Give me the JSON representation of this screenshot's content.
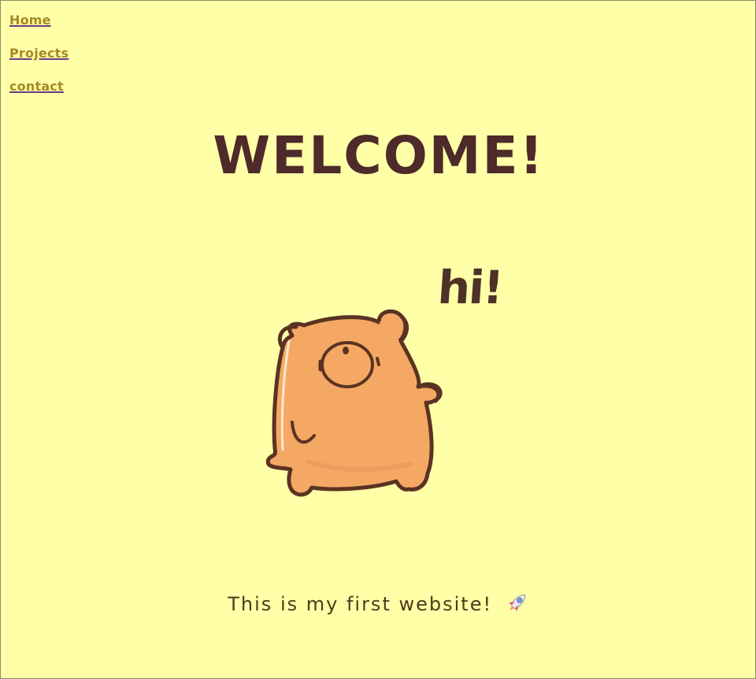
{
  "nav": {
    "items": [
      {
        "label": "Home"
      },
      {
        "label": "Projects"
      },
      {
        "label": "contact"
      }
    ]
  },
  "main": {
    "title": "WELCOME!",
    "speech": "hi!",
    "tagline": "This is my first website!"
  },
  "colors": {
    "background": "#ffffa8",
    "title": "#4e2a2a",
    "nav_link": "#a58a22",
    "bear_fill": "#f5a864",
    "bear_outline": "#5a3322"
  },
  "icons": {
    "illustration": "bear-waving-icon",
    "tagline_emoji": "rocket-icon"
  }
}
